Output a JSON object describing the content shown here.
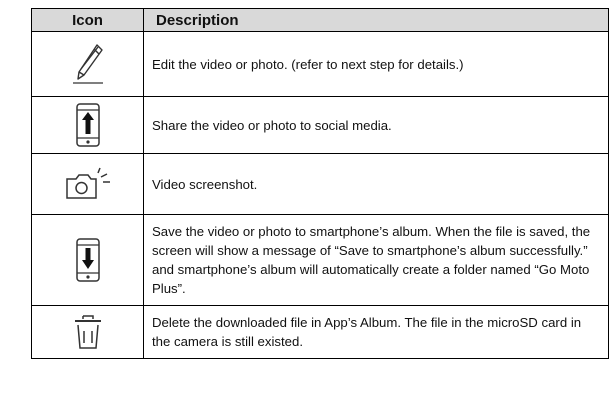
{
  "table": {
    "headers": {
      "icon": "Icon",
      "description": "Description"
    },
    "rows": [
      {
        "icon": "edit-pencil-icon",
        "description": "Edit the video or photo. (refer to next step for details.)"
      },
      {
        "icon": "share-phone-icon",
        "description": "Share the video or photo to social media."
      },
      {
        "icon": "camera-screenshot-icon",
        "description": "Video screenshot."
      },
      {
        "icon": "save-to-phone-icon",
        "description": "Save the video or photo to smartphone’s album. When the file is saved, the screen will show a message of “Save to smartphone’s album successfully.” and smartphone’s album will automatically create a folder named “Go Moto Plus”."
      },
      {
        "icon": "trash-delete-icon",
        "description": "Delete the downloaded file in App’s Album. The file in the microSD card in the camera is still existed."
      }
    ]
  }
}
